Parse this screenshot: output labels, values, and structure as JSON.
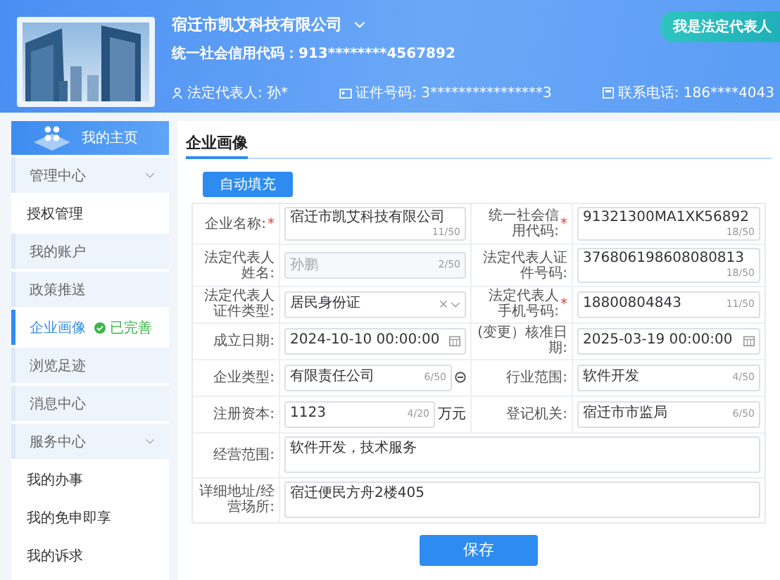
{
  "header": {
    "company_name": "宿迁市凯艾科技有限公司",
    "credit_code": "统一社会信用代码：913********4567892",
    "legal_rep": "法定代表人: 孙*",
    "id_number": "证件号码: 3****************3",
    "phone": "联系电话: 186****4043",
    "role_button": "我是法定代表人"
  },
  "sidebar": {
    "home": "我的主页",
    "items": [
      {
        "label": "管理中心",
        "kind": "group",
        "expanded": true,
        "selected": false
      },
      {
        "label": "授权管理",
        "kind": "sub",
        "selected": false
      },
      {
        "label": "我的账户",
        "kind": "item",
        "selected": false
      },
      {
        "label": "政策推送",
        "kind": "item",
        "selected": false
      },
      {
        "label": "企业画像",
        "kind": "item",
        "selected": true,
        "badge": "已完善"
      },
      {
        "label": "浏览足迹",
        "kind": "item",
        "selected": false
      },
      {
        "label": "消息中心",
        "kind": "item",
        "selected": false
      },
      {
        "label": "服务中心",
        "kind": "group",
        "expanded": true,
        "selected": false
      },
      {
        "label": "我的办事",
        "kind": "sub",
        "selected": false
      },
      {
        "label": "我的免申即享",
        "kind": "sub",
        "selected": false
      },
      {
        "label": "我的诉求",
        "kind": "sub",
        "selected": false
      }
    ]
  },
  "main": {
    "title": "企业画像",
    "autofill_button": "自动填充",
    "save_button": "保存",
    "rows": [
      [
        {
          "label": "企业名称:",
          "required_mark": "*",
          "kind": "text",
          "value": "宿迁市凯艾科技有限公司",
          "count": "11/50"
        },
        {
          "label": "统一社会信用代码:",
          "required_mark": "*",
          "kind": "text",
          "value": "91321300MA1XK56892",
          "count": "18/50"
        }
      ],
      [
        {
          "label": "法定代表人姓名:",
          "kind": "text",
          "value": "孙鹏",
          "disabled": true,
          "count": "2/50"
        },
        {
          "label": "法定代表人证件号码:",
          "kind": "text",
          "value": "376806198608080813",
          "count": "18/50"
        }
      ],
      [
        {
          "label": "法定代表人证件类型:",
          "kind": "select",
          "value": "居民身份证"
        },
        {
          "label": "法定代表人手机号码:",
          "required_mark": "*",
          "kind": "text",
          "value": "18800804843",
          "count": "11/50"
        }
      ],
      [
        {
          "label": "成立日期:",
          "kind": "date",
          "value": "2024-10-10 00:00:00"
        },
        {
          "label": "(变更）核准日期:",
          "kind": "date",
          "value": "2025-03-19 00:00:00"
        }
      ],
      [
        {
          "label": "企业类型:",
          "kind": "text",
          "value": "有限责任公司",
          "count": "6/50",
          "side_icon": true
        },
        {
          "label": "行业范围:",
          "kind": "text",
          "value": "软件开发",
          "count": "4/50"
        }
      ],
      [
        {
          "label": "注册资本:",
          "kind": "text",
          "value": "1123",
          "count": "4/20",
          "unit": "万元"
        },
        {
          "label": "登记机关:",
          "kind": "text",
          "value": "宿迁市市监局",
          "count": "6/50"
        }
      ],
      [
        {
          "label": "经营范围:",
          "kind": "textarea",
          "value": "软件开发，技术服务"
        }
      ],
      [
        {
          "label": "详细地址/经营场所:",
          "kind": "textarea",
          "value": "宿迁便民方舟2楼405"
        }
      ]
    ]
  }
}
